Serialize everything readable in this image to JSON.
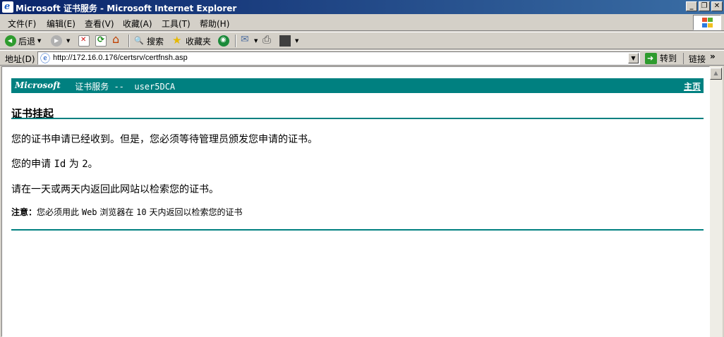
{
  "window": {
    "title": "Microsoft 证书服务 - Microsoft Internet Explorer",
    "minimize_label": "_",
    "maximize_label": "❐",
    "close_label": "✕"
  },
  "menu": {
    "items": [
      "文件(F)",
      "编辑(E)",
      "查看(V)",
      "收藏(A)",
      "工具(T)",
      "帮助(H)"
    ]
  },
  "toolbar": {
    "back_label": "后退",
    "search_label": "搜索",
    "favorites_label": "收藏夹"
  },
  "address": {
    "label": "地址(D)",
    "url": "http://172.16.0.176/certsrv/certfnsh.asp",
    "go_label": "转到",
    "links_label": "链接",
    "more_label": "»"
  },
  "page": {
    "brand": "Microsoft",
    "service_title": " 证书服务 --  user5DCA",
    "home_link": "主页",
    "heading": "证书挂起",
    "line1": "您的证书申请已经收到。但是，您必须等待管理员颁发您申请的证书。",
    "line2_prefix": "您的申请 ",
    "line2_id_text": "Id",
    "line2_mid": " 为 ",
    "line2_value": "2",
    "line2_suffix": "。",
    "line3": "请在一天或两天内返回此网站以检索您的证书。",
    "note_label": "注意：",
    "note_part1": "您必须用此 ",
    "note_web": "Web",
    "note_part2": " 浏览器在 ",
    "note_days": "10",
    "note_part3": " 天内返回以检索您的证书"
  },
  "colors": {
    "accent": "#008080",
    "titlebar_start": "#0a246a",
    "titlebar_end": "#3a6ea5"
  }
}
